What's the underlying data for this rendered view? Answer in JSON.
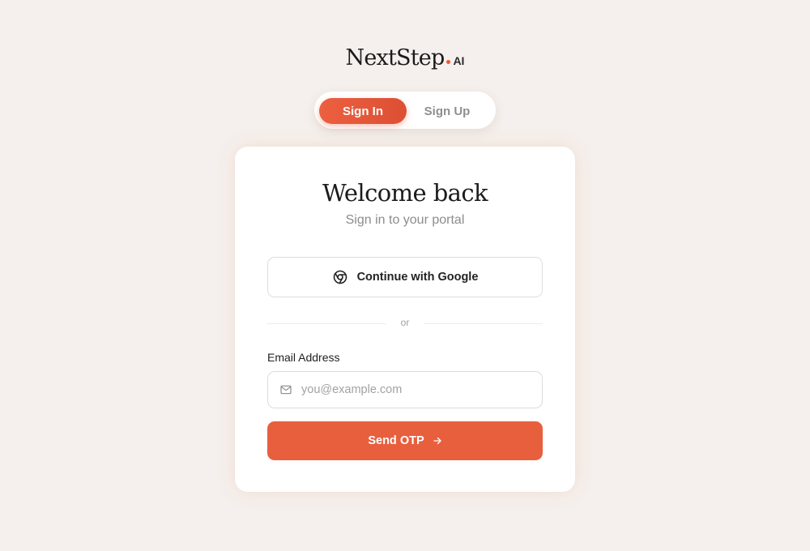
{
  "brand": {
    "name": "NextStep",
    "suffix": "AI",
    "accent_color": "#e85a3a"
  },
  "auth_tabs": {
    "sign_in": "Sign In",
    "sign_up": "Sign Up",
    "active": "sign_in"
  },
  "card": {
    "title": "Welcome back",
    "subtitle": "Sign in to your portal",
    "google_button": {
      "label": "Continue with Google",
      "icon": "google-chrome-icon"
    },
    "divider_text": "or",
    "email": {
      "label": "Email Address",
      "placeholder": "you@example.com",
      "value": "",
      "icon": "mail-icon"
    },
    "submit": {
      "label": "Send OTP",
      "icon": "arrow-right-icon",
      "color": "#e85f3e"
    }
  }
}
